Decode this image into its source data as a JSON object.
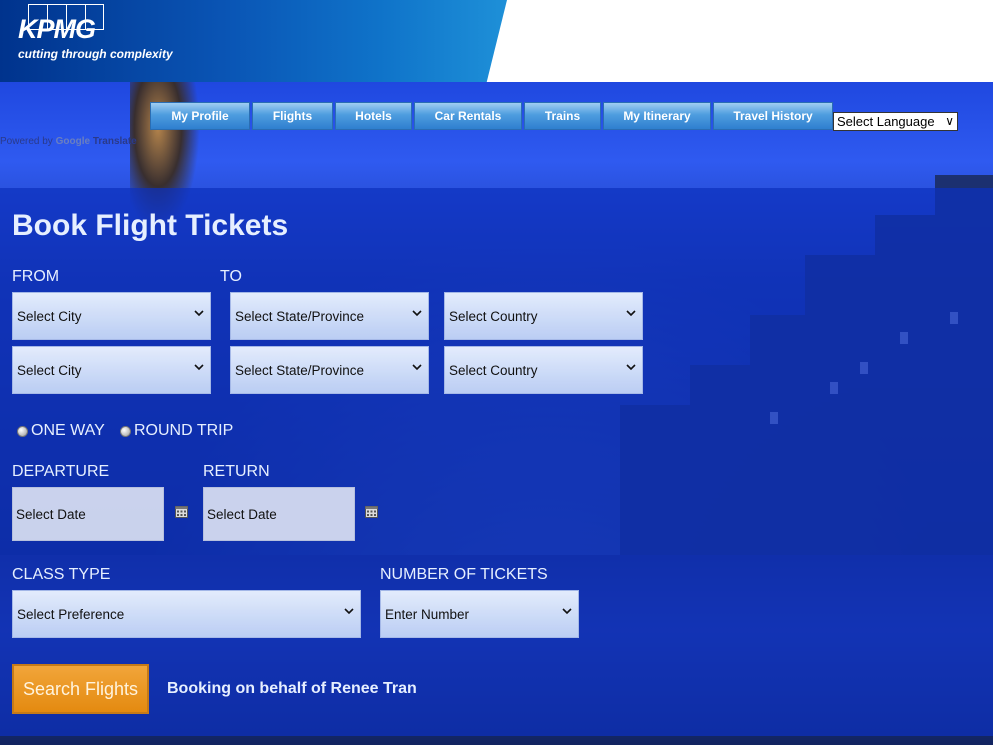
{
  "header": {
    "logo_text": "KPMG",
    "tagline": "cutting through complexity"
  },
  "nav": {
    "items": [
      {
        "label": "My Profile"
      },
      {
        "label": "Flights"
      },
      {
        "label": "Hotels"
      },
      {
        "label": "Car Rentals"
      },
      {
        "label": "Trains"
      },
      {
        "label": "My Itinerary"
      },
      {
        "label": "Travel History"
      }
    ],
    "language_select": "Select Language"
  },
  "translate": {
    "powered_by": "Powered by",
    "google": "Google",
    "translate": "Translate"
  },
  "form": {
    "title": "Book Flight Tickets",
    "from_label": "FROM",
    "to_label": "TO",
    "rows": [
      {
        "city": "Select City",
        "state": "Select State/Province",
        "country": "Select Country"
      },
      {
        "city": "Select City",
        "state": "Select State/Province",
        "country": "Select Country"
      }
    ],
    "trip_one_way": "ONE WAY",
    "trip_round": "ROUND TRIP",
    "departure_label": "DEPARTURE",
    "return_label": "RETURN",
    "departure_value": "Select Date",
    "return_value": "Select Date",
    "class_label": "CLASS TYPE",
    "class_value": "Select Preference",
    "tickets_label": "NUMBER OF TICKETS",
    "tickets_value": "Enter Number",
    "search_button": "Search Flights",
    "behalf_text": "Booking on behalf of Renee Tran"
  },
  "colors": {
    "brand_blue": "#00338d",
    "panel_blue": "#0c30be",
    "button_orange": "#e48a10"
  }
}
